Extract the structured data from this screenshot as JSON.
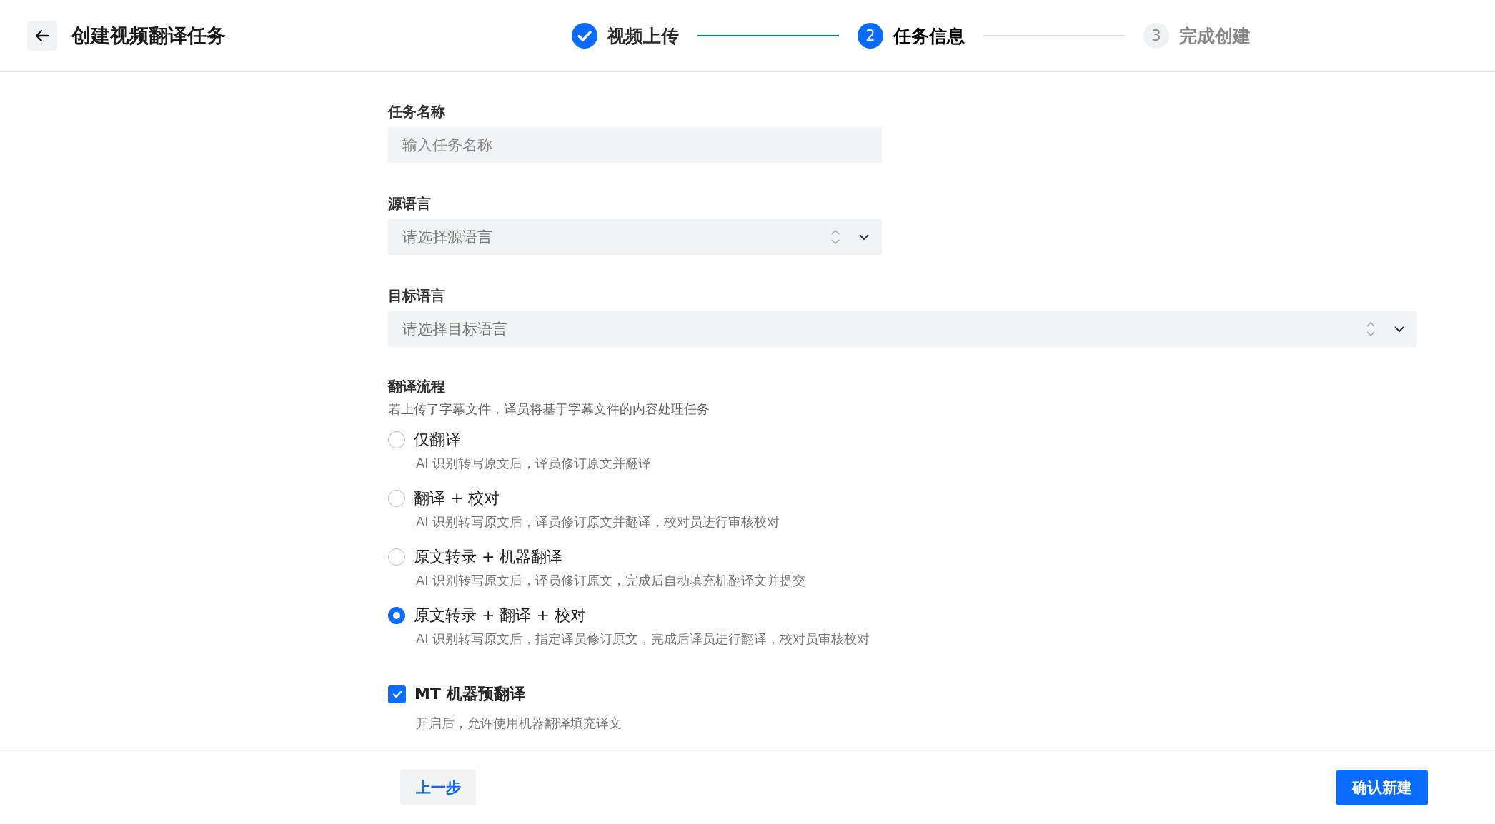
{
  "header": {
    "title": "创建视频翻译任务"
  },
  "steps": [
    {
      "label": "视频上传",
      "completed": true,
      "selected": false
    },
    {
      "number": "2",
      "label": "任务信息",
      "completed": false,
      "selected": true
    },
    {
      "number": "3",
      "label": "完成创建",
      "completed": false,
      "selected": false
    }
  ],
  "form": {
    "task_name": {
      "label": "任务名称",
      "placeholder": "输入任务名称"
    },
    "source_language": {
      "label": "源语言",
      "placeholder": "请选择源语言"
    },
    "target_language": {
      "label": "目标语言",
      "placeholder": "请选择目标语言"
    },
    "workflow": {
      "label": "翻译流程",
      "hint": "若上传了字幕文件，译员将基于字幕文件的内容处理任务",
      "options": [
        {
          "label": "仅翻译",
          "description": "AI 识别转写原文后，译员修订原文并翻译",
          "selected": false
        },
        {
          "label": "翻译 + 校对",
          "description": "AI 识别转写原文后，译员修订原文并翻译，校对员进行审核校对",
          "selected": false
        },
        {
          "label": "原文转录 + 机器翻译",
          "description": "AI 识别转写原文后，译员修订原文，完成后自动填充机翻译文并提交",
          "selected": false
        },
        {
          "label": "原文转录 + 翻译 + 校对",
          "description": "AI 识别转写原文后，指定译员修订原文，完成后译员进行翻译，校对员审核校对",
          "selected": true
        }
      ]
    },
    "mt": {
      "label": "MT 机器预翻译",
      "description": "开启后，允许使用机器翻译填充译文",
      "checked": true
    }
  },
  "footer": {
    "back": "上一步",
    "confirm": "确认新建"
  }
}
